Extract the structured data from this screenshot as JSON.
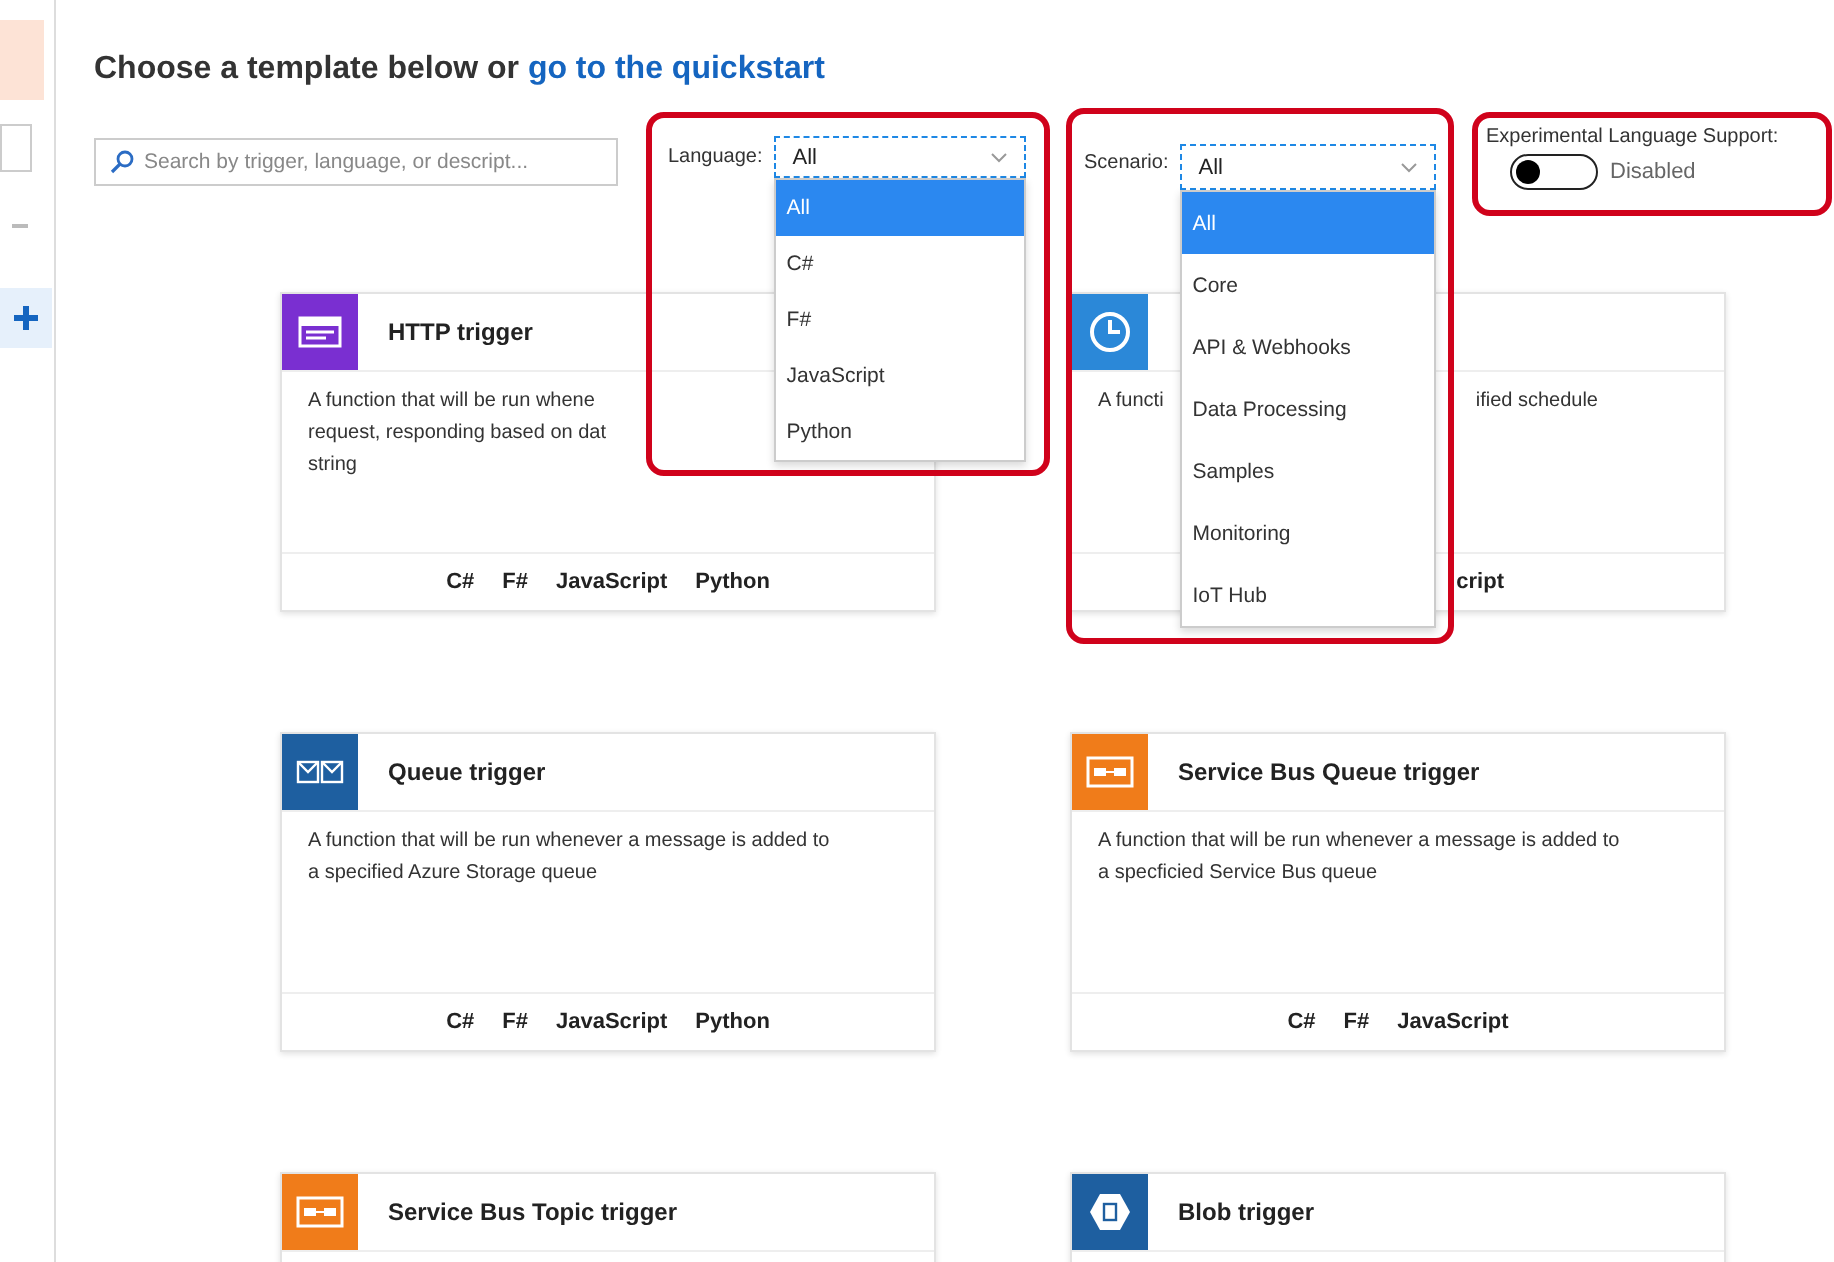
{
  "heading": {
    "text": "Choose a template below or",
    "link": "go to the quickstart"
  },
  "search": {
    "placeholder": "Search by trigger, language, or descript..."
  },
  "language": {
    "label": "Language:",
    "value": "All",
    "options": [
      {
        "label": "All",
        "selected": true
      },
      {
        "label": "C#",
        "selected": false
      },
      {
        "label": "F#",
        "selected": false
      },
      {
        "label": "JavaScript",
        "selected": false
      },
      {
        "label": "Python",
        "selected": false
      }
    ]
  },
  "scenario": {
    "label": "Scenario:",
    "value": "All",
    "options": [
      {
        "label": "All",
        "selected": true
      },
      {
        "label": "Core",
        "selected": false
      },
      {
        "label": "API & Webhooks",
        "selected": false
      },
      {
        "label": "Data Processing",
        "selected": false
      },
      {
        "label": "Samples",
        "selected": false
      },
      {
        "label": "Monitoring",
        "selected": false
      },
      {
        "label": "IoT Hub",
        "selected": false
      }
    ]
  },
  "experimental": {
    "label": "Experimental Language Support:",
    "on": false,
    "state_text": "Disabled"
  },
  "cards": [
    {
      "kind": "http",
      "color": "#7a2fd1",
      "title": "HTTP trigger",
      "partial": false,
      "description_lines": [
        [
          "A function that will be run whene"
        ],
        [
          "request, responding based on dat"
        ],
        [
          "string"
        ]
      ],
      "languages": [
        "C#",
        "F#",
        "JavaScript",
        "Python"
      ]
    },
    {
      "kind": "clock",
      "color": "#2b88d8",
      "partial": true,
      "description_lines": [
        [
          "A functi",
          "ified schedule"
        ]
      ],
      "languages": [
        "cript"
      ]
    },
    {
      "kind": "queue",
      "color": "#1e5fa0",
      "title": "Queue trigger",
      "partial": false,
      "description_lines": [
        [
          "A function that will be run whenever a message is added to"
        ],
        [
          "a specified Azure Storage queue"
        ]
      ],
      "languages": [
        "C#",
        "F#",
        "JavaScript",
        "Python"
      ]
    },
    {
      "kind": "servicebus",
      "color": "#f07c1a",
      "title": "Service Bus Queue trigger",
      "partial": false,
      "description_lines": [
        [
          "A function that will be run whenever a message is added to"
        ],
        [
          "a specficied Service Bus queue"
        ]
      ],
      "languages": [
        "C#",
        "F#",
        "JavaScript"
      ]
    },
    {
      "kind": "servicebus",
      "color": "#f07c1a",
      "title": "Service Bus Topic trigger"
    },
    {
      "kind": "blob",
      "color": "#1e5fa0",
      "title": "Blob trigger"
    }
  ]
}
